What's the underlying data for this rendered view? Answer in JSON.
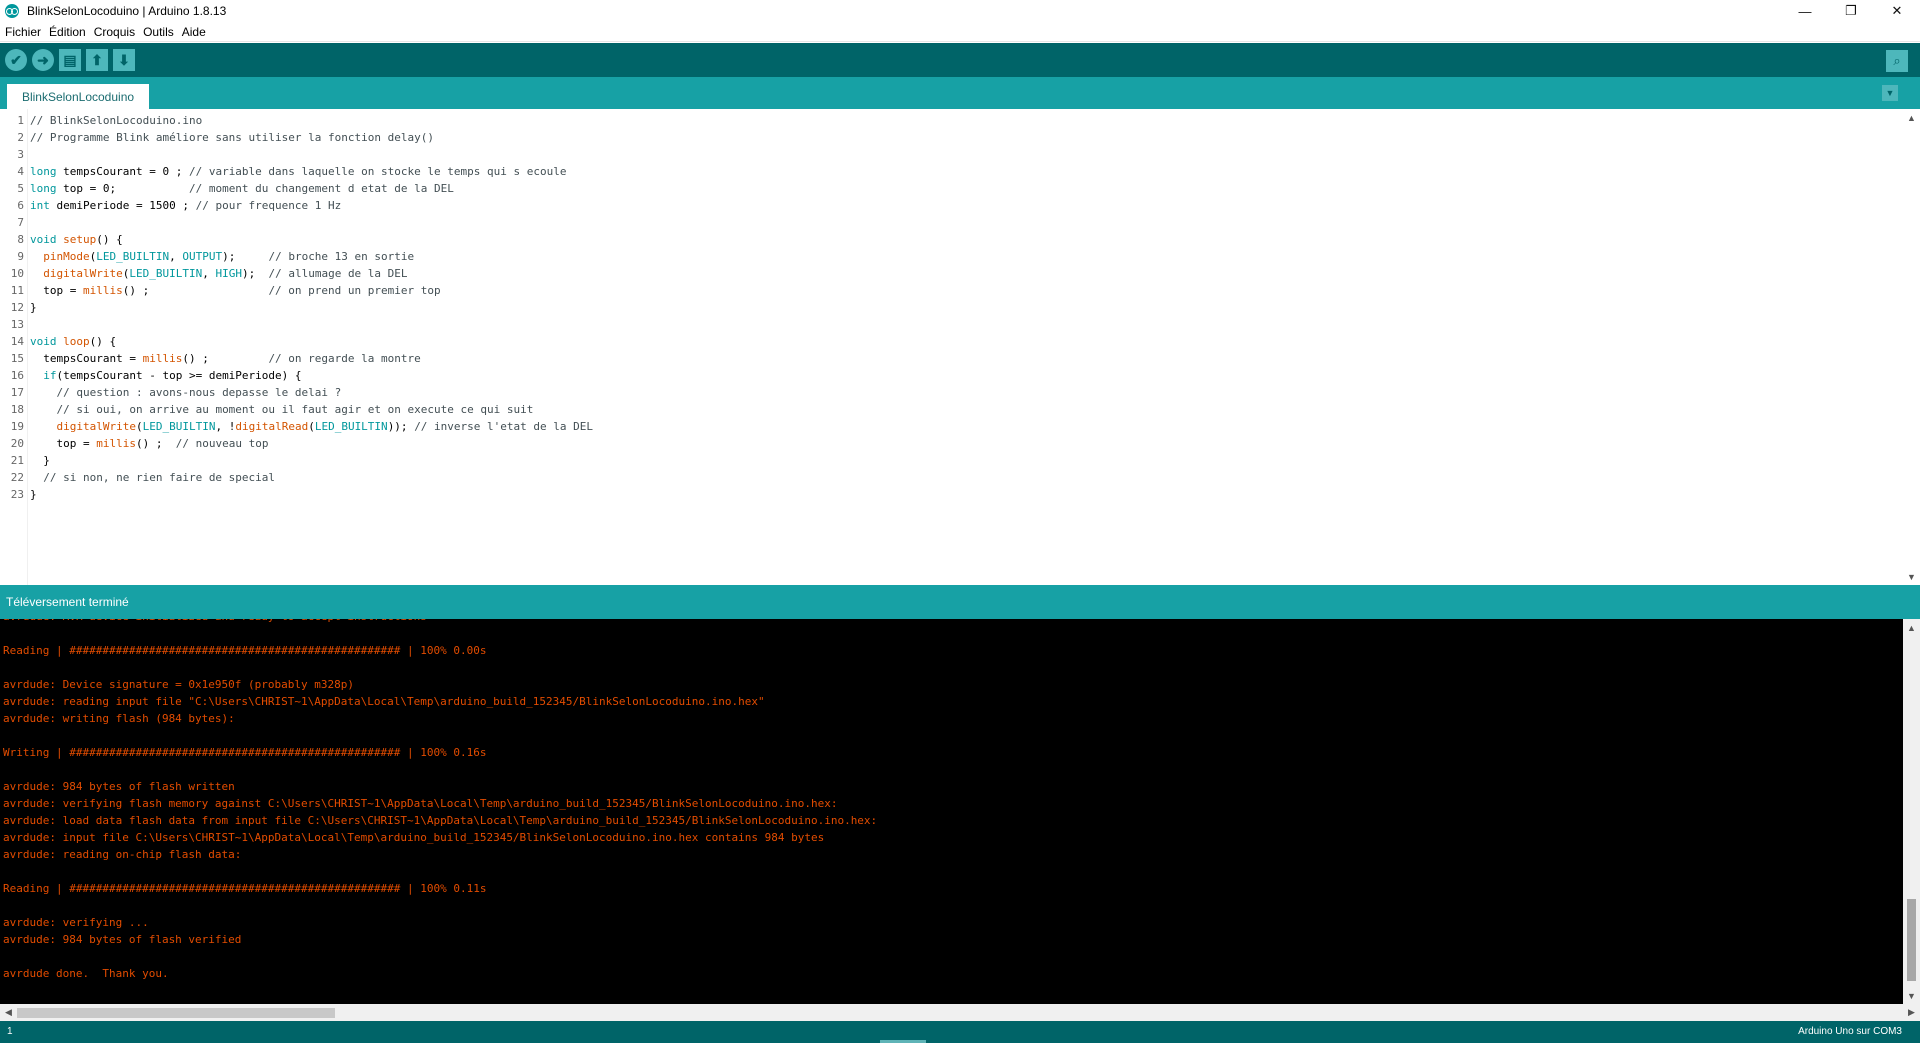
{
  "window": {
    "title": "BlinkSelonLocoduino | Arduino 1.8.13",
    "controls": {
      "minimize": "—",
      "maximize": "❐",
      "close": "✕"
    }
  },
  "menu": [
    "Fichier",
    "Édition",
    "Croquis",
    "Outils",
    "Aide"
  ],
  "toolbar": {
    "buttons": [
      {
        "name": "verify-button",
        "icon": "check-icon",
        "glyph": "✔"
      },
      {
        "name": "upload-button",
        "icon": "arrow-right-icon",
        "glyph": "➜"
      },
      {
        "name": "new-button",
        "icon": "new-file-icon",
        "glyph": "▤"
      },
      {
        "name": "open-button",
        "icon": "arrow-up-icon",
        "glyph": "⬆"
      },
      {
        "name": "save-button",
        "icon": "arrow-down-icon",
        "glyph": "⬇"
      }
    ],
    "serial_monitor_icon": "magnifier-icon",
    "serial_monitor_glyph": "⌕"
  },
  "tabs": {
    "active": "BlinkSelonLocoduino",
    "menu_glyph": "▼"
  },
  "code_lines": [
    "// BlinkSelonLocoduino.ino",
    "// Programme Blink améliore sans utiliser la fonction delay()",
    "",
    "long tempsCourant = 0 ; // variable dans laquelle on stocke le temps qui s ecoule",
    "long top = 0;           // moment du changement d etat de la DEL",
    "int demiPeriode = 1500 ; // pour frequence 1 Hz",
    "",
    "void setup() {",
    "  pinMode(LED_BUILTIN, OUTPUT);     // broche 13 en sortie",
    "  digitalWrite(LED_BUILTIN, HIGH);  // allumage de la DEL",
    "  top = millis() ;                  // on prend un premier top",
    "}",
    "",
    "void loop() {",
    "  tempsCourant = millis() ;         // on regarde la montre",
    "  if(tempsCourant - top >= demiPeriode) {",
    "    // question : avons-nous depasse le delai ?",
    "    // si oui, on arrive au moment ou il faut agir et on execute ce qui suit",
    "    digitalWrite(LED_BUILTIN, !digitalRead(LED_BUILTIN)); // inverse l'etat de la DEL",
    "    top = millis() ;  // nouveau top",
    "  }",
    "  // si non, ne rien faire de special",
    "}"
  ],
  "status_message": "Téléversement terminé",
  "console_lines": [
    "avrdude: AVR device initialized and ready to accept instructions",
    "",
    "Reading | ################################################## | 100% 0.00s",
    "",
    "avrdude: Device signature = 0x1e950f (probably m328p)",
    "avrdude: reading input file \"C:\\Users\\CHRIST~1\\AppData\\Local\\Temp\\arduino_build_152345/BlinkSelonLocoduino.ino.hex\"",
    "avrdude: writing flash (984 bytes):",
    "",
    "Writing | ################################################## | 100% 0.16s",
    "",
    "avrdude: 984 bytes of flash written",
    "avrdude: verifying flash memory against C:\\Users\\CHRIST~1\\AppData\\Local\\Temp\\arduino_build_152345/BlinkSelonLocoduino.ino.hex:",
    "avrdude: load data flash data from input file C:\\Users\\CHRIST~1\\AppData\\Local\\Temp\\arduino_build_152345/BlinkSelonLocoduino.ino.hex:",
    "avrdude: input file C:\\Users\\CHRIST~1\\AppData\\Local\\Temp\\arduino_build_152345/BlinkSelonLocoduino.ino.hex contains 984 bytes",
    "avrdude: reading on-chip flash data:",
    "",
    "Reading | ################################################## | 100% 0.11s",
    "",
    "avrdude: verifying ...",
    "avrdude: 984 bytes of flash verified",
    "",
    "avrdude done.  Thank you."
  ],
  "bottom": {
    "line_number": "1",
    "board": "Arduino Uno sur COM3"
  },
  "colors": {
    "toolbar": "#006468",
    "tabs_bar": "#17a1a5",
    "console_text": "#e34c00",
    "keyword_type": "#00979c",
    "keyword_function": "#d35400",
    "comment": "#434f54"
  }
}
